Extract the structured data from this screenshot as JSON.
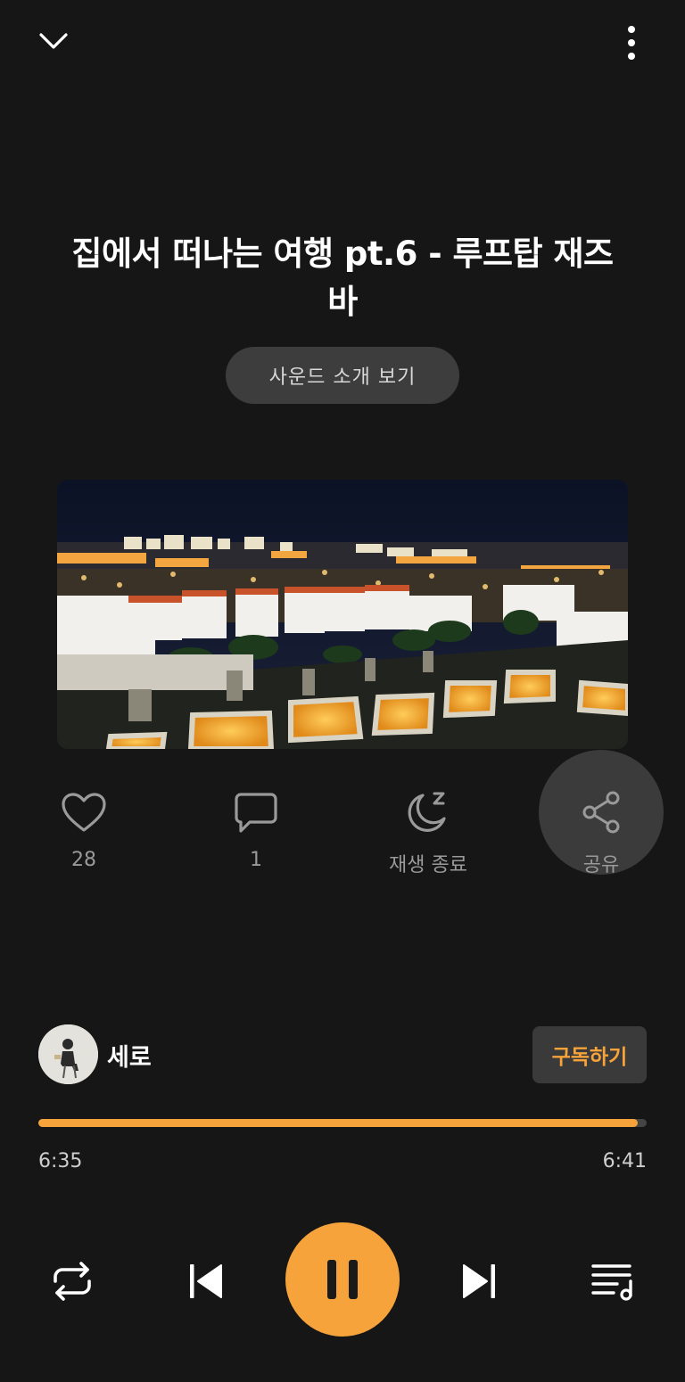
{
  "header": {
    "collapse_icon": "chevron-down-icon",
    "more_icon": "more-vertical-icon"
  },
  "title": "집에서 떠나는 여행 pt.6 - 루프탑 재즈바",
  "intro_button": "사운드 소개 보기",
  "cover": {
    "icon": "night-city-rooftop-image"
  },
  "actions": {
    "like": {
      "icon": "heart-icon",
      "label": "28"
    },
    "comment": {
      "icon": "comment-icon",
      "label": "1"
    },
    "sleep_timer": {
      "icon": "moon-icon",
      "label": "재생 종료"
    },
    "share": {
      "icon": "share-icon",
      "label": "공유"
    }
  },
  "channel": {
    "name": "세로",
    "subscribe_label": "구독하기",
    "avatar_icon": "avatar"
  },
  "player": {
    "current_time": "6:35",
    "total_time": "6:41",
    "progress": 0.985,
    "accent": "#f5a33a"
  },
  "controls": {
    "repeat_icon": "repeat-icon",
    "previous_icon": "skip-previous-icon",
    "pause_icon": "pause-icon",
    "next_icon": "skip-next-icon",
    "playlist_icon": "playlist-icon"
  }
}
